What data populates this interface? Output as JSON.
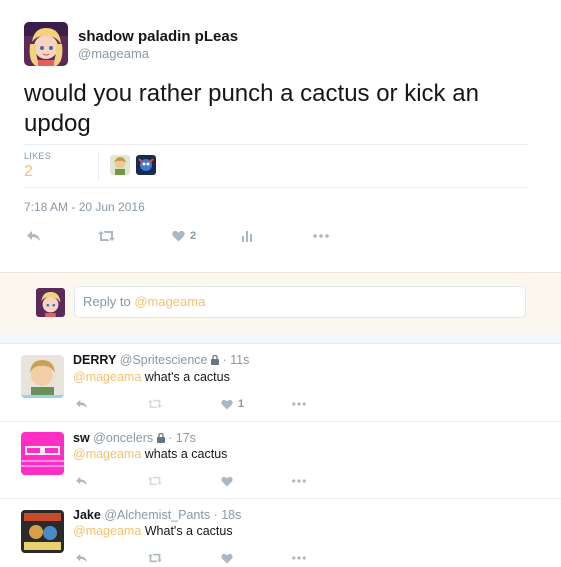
{
  "tweet": {
    "display_name": "shadow paladin pLeas",
    "handle": "@mageama",
    "text": "would you rather punch a cactus or kick an updog",
    "likes_label": "LIKES",
    "likes_count": "2",
    "timestamp": "7:18 AM - 20 Jun 2016",
    "like_action_count": "2"
  },
  "reply_box": {
    "prefix": "Reply to ",
    "mention": "@mageama"
  },
  "replies": [
    {
      "name": "DERRY",
      "handle": "@Spritescience",
      "time": "· 11s",
      "mention": "@mageama",
      "text": " what's a cactus",
      "like_count": "1"
    },
    {
      "name": "sw",
      "handle": "@oncelers",
      "time": "· 17s",
      "mention": "@mageama",
      "text": " whats a cactus",
      "like_count": ""
    },
    {
      "name": "Jake",
      "handle": "@Alchemist_Pants",
      "time": "· 18s",
      "mention": "@mageama",
      "text": " What's a cactus",
      "like_count": ""
    }
  ],
  "colors": {
    "accent": "#f5c16c",
    "muted": "#8899a6",
    "icon": "#aab8c2",
    "text": "#14171a"
  }
}
